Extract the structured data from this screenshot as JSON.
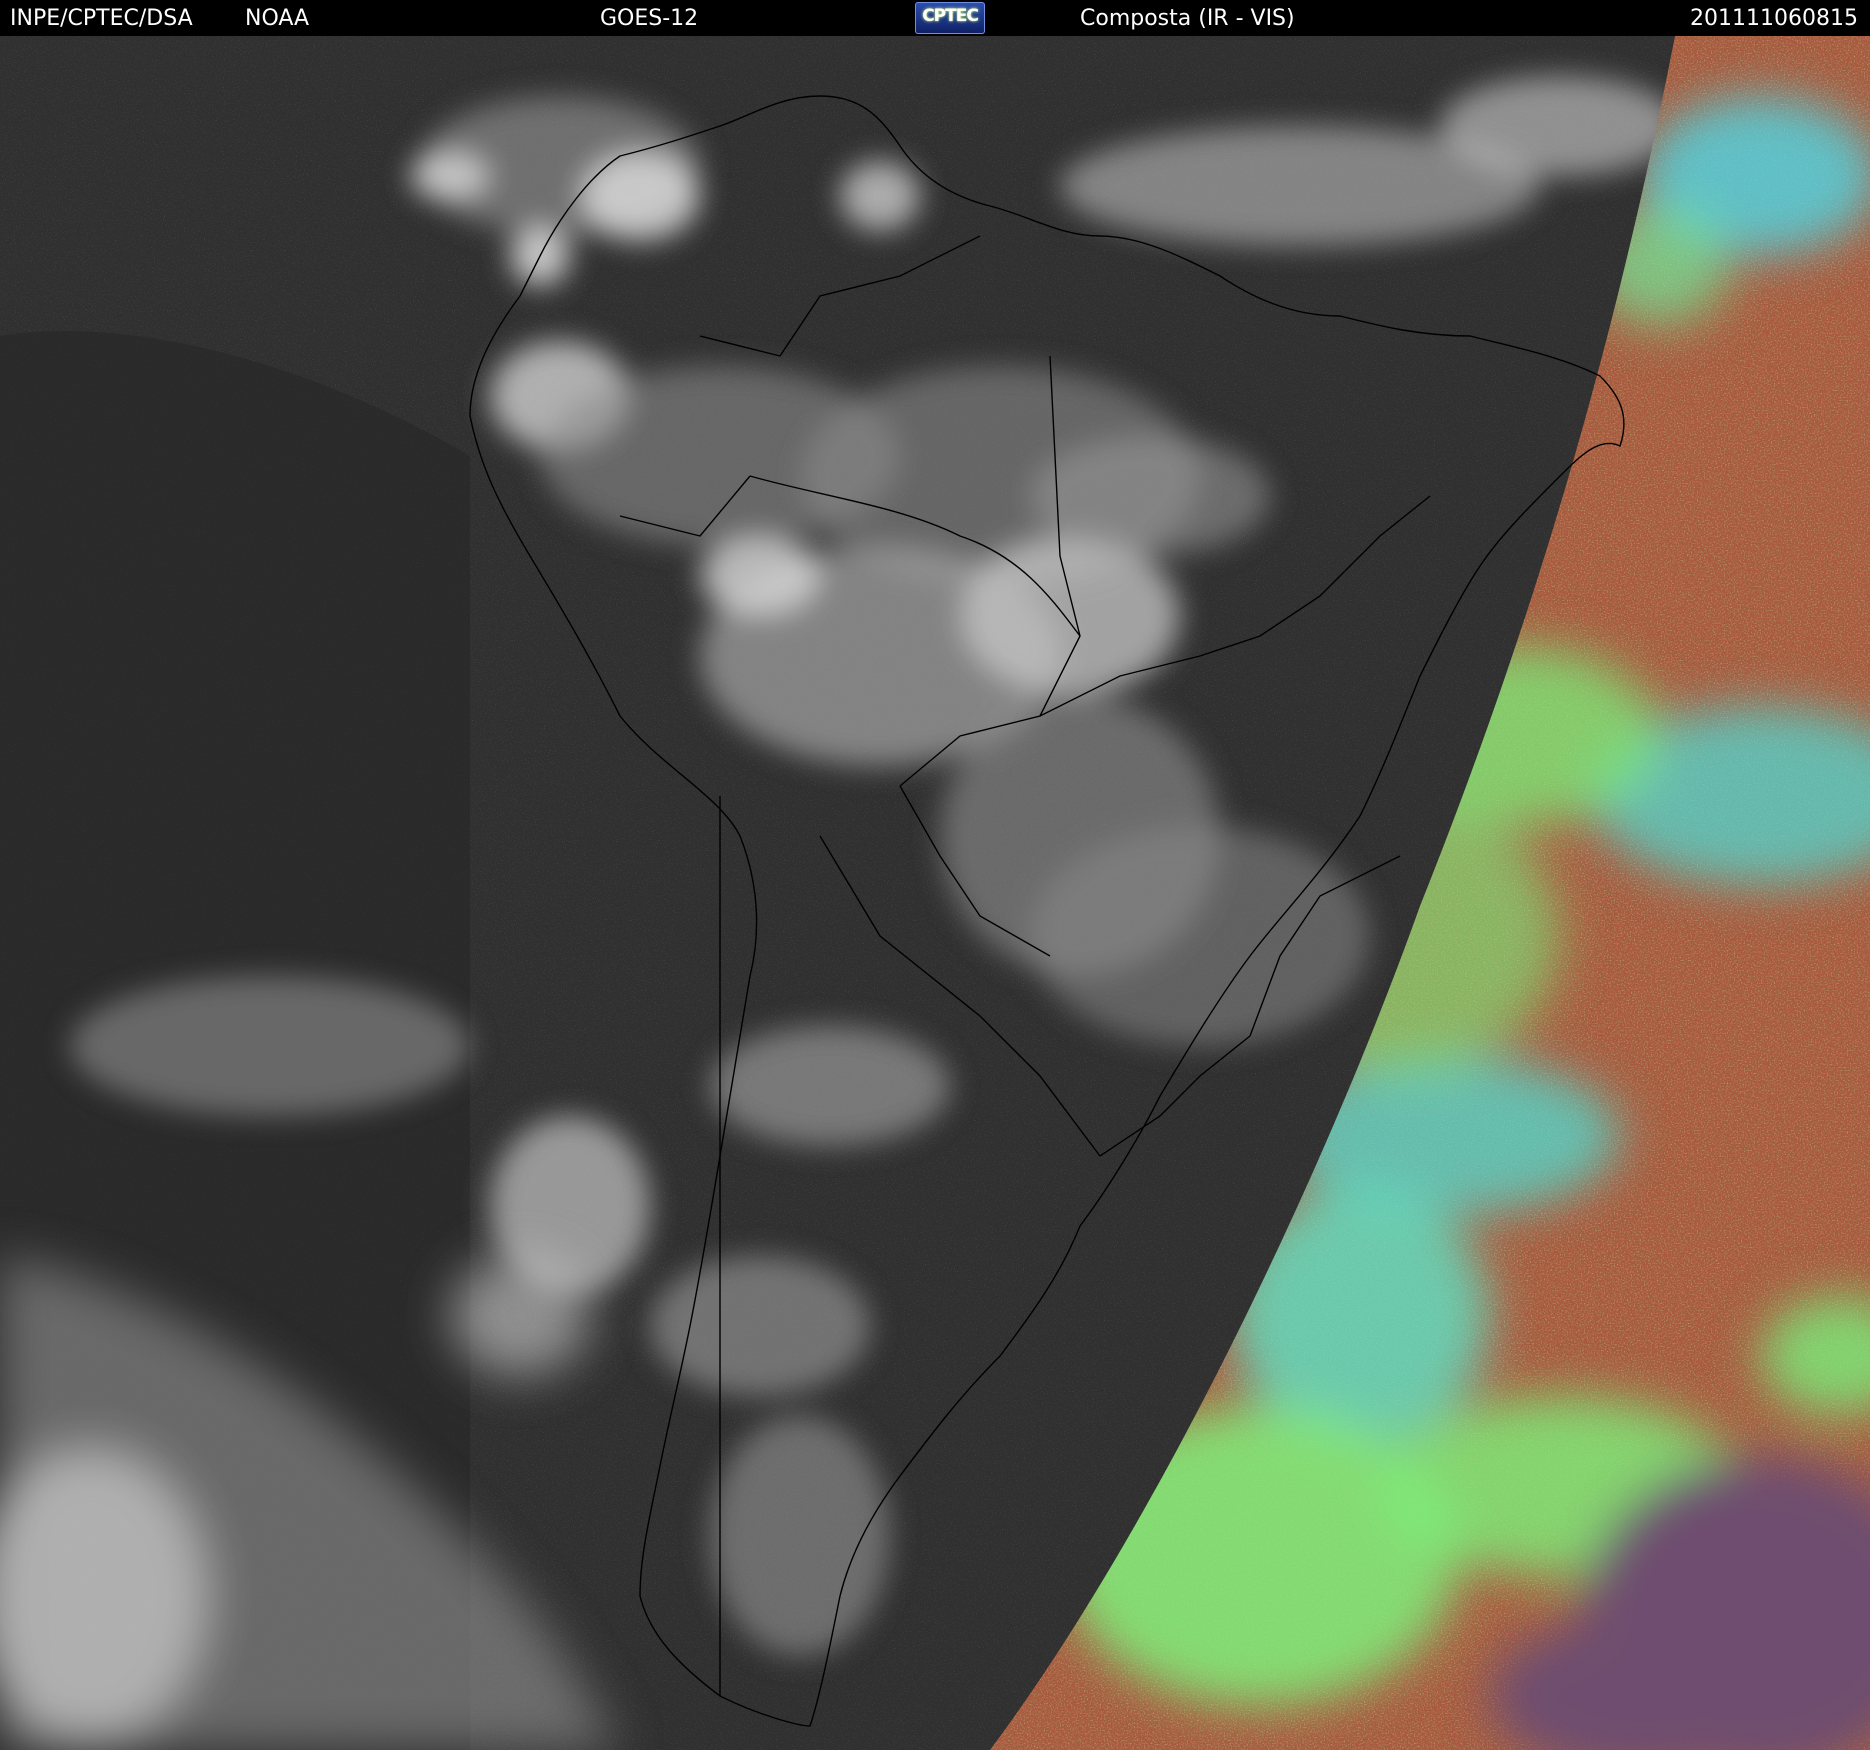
{
  "header": {
    "agency": "INPE/CPTEC/DSA",
    "partner": "NOAA",
    "satellite": "GOES-12",
    "logo_text": "CPTEC",
    "product": "Composta (IR - VIS)",
    "timestamp": "201111060815"
  },
  "colors": {
    "header_bg": "#000000",
    "header_text": "#ffffff",
    "ir_background": "#303030",
    "cloud": "#d8d8d8",
    "vis_ocean": "#6e4d70",
    "vis_land": "#a8593e",
    "vis_cloud_low": "#7cf07a",
    "vis_cloud_high": "#49e8d2",
    "border_lines": "#000000"
  },
  "icons": [
    "cptec-logo-icon"
  ]
}
